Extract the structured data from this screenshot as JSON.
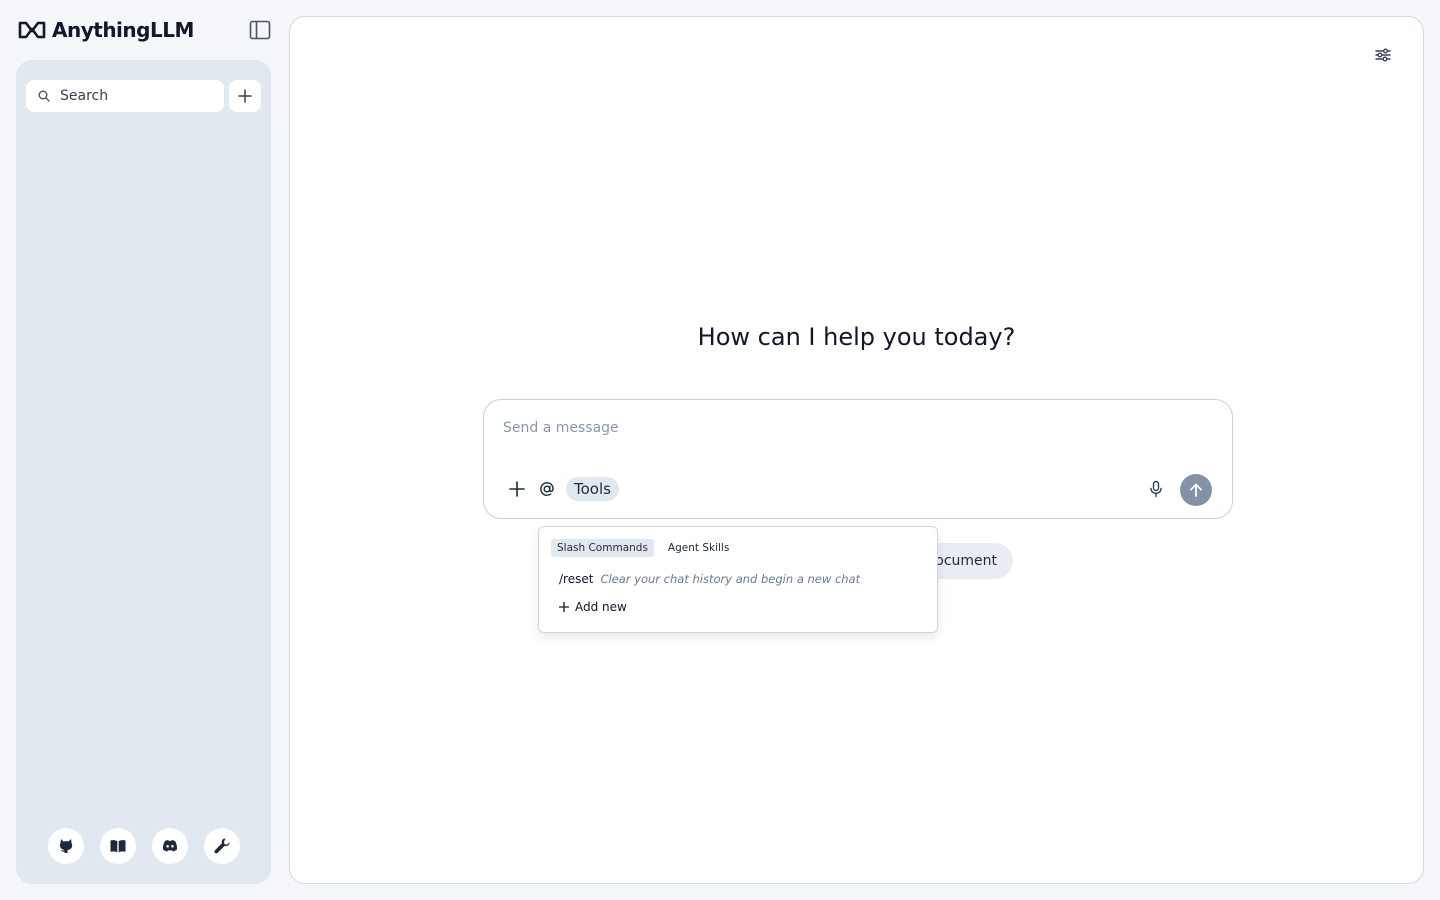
{
  "app": {
    "brand_name": "AnythingLLM"
  },
  "sidebar": {
    "search_placeholder": "Search",
    "footer_icons": [
      "github-icon",
      "book-icon",
      "discord-icon",
      "wrench-icon"
    ]
  },
  "main": {
    "greeting": "How can I help you today?",
    "composer": {
      "placeholder": "Send a message",
      "tools_label": "Tools"
    },
    "suggestion_chip_label": "ocument"
  },
  "popup": {
    "tabs": [
      {
        "label": "Slash Commands",
        "active": true
      },
      {
        "label": "Agent Skills",
        "active": false
      }
    ],
    "commands": [
      {
        "name": "/reset",
        "description": "Clear your chat history and begin a new chat"
      }
    ],
    "add_new_label": "Add new"
  },
  "colors": {
    "sidebar_bg": "#e2e8f0",
    "send_button": "#8392a7",
    "page_bg": "#f4f6f9"
  }
}
